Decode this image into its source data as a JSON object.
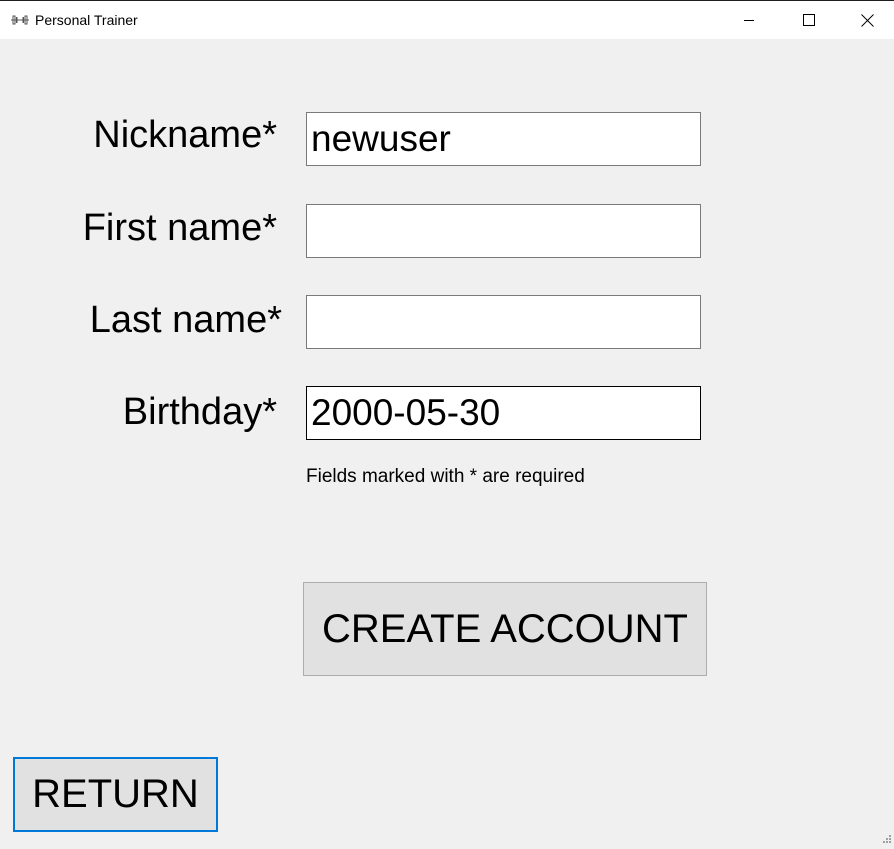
{
  "window": {
    "title": "Personal Trainer",
    "app_icon": "dumbbell-icon",
    "controls": {
      "minimize_icon": "minimize-icon",
      "maximize_icon": "maximize-icon",
      "close_icon": "close-icon"
    }
  },
  "form": {
    "fields": [
      {
        "label": "Nickname*",
        "value": "newuser",
        "placeholder": ""
      },
      {
        "label": "First name*",
        "value": "",
        "placeholder": ""
      },
      {
        "label": "Last name*",
        "value": "",
        "placeholder": ""
      },
      {
        "label": "Birthday*",
        "value": "2000-05-30",
        "placeholder": ""
      }
    ],
    "hint": "Fields marked with * are required"
  },
  "buttons": {
    "create_account": "CREATE ACCOUNT",
    "return": "RETURN"
  },
  "colors": {
    "background": "#f0f0f0",
    "focus_border": "#0078d7",
    "button_face": "#e1e1e1"
  }
}
